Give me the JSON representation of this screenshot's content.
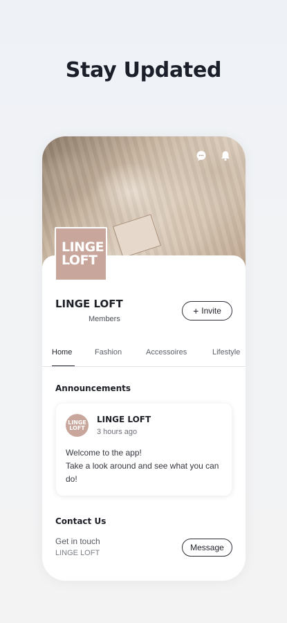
{
  "headline": "Stay Updated",
  "group": {
    "logo_line1": "LINGE",
    "logo_line2": "LOFT",
    "name": "LINGE LOFT",
    "members_label": "Members",
    "invite_label": "Invite",
    "invite_icon": "plus-icon"
  },
  "header_icons": [
    "chat-icon",
    "bell-icon"
  ],
  "tabs": [
    {
      "label": "Home",
      "active": true
    },
    {
      "label": "Fashion",
      "active": false
    },
    {
      "label": "Accessoires",
      "active": false
    },
    {
      "label": "Lifestyle",
      "active": false
    }
  ],
  "announcements": {
    "title": "Announcements",
    "post": {
      "avatar_line1": "LINGE",
      "avatar_line2": "LOFT",
      "author": "LINGE LOFT",
      "time": "3 hours ago",
      "line1": "Welcome to the app!",
      "line2": "Take a look around and see what you can do!"
    }
  },
  "contact": {
    "title": "Contact Us",
    "line1": "Get in touch",
    "line2": "LINGE LOFT",
    "message_label": "Message"
  },
  "colors": {
    "brand": "#c9a69c",
    "text": "#1c1f26"
  }
}
